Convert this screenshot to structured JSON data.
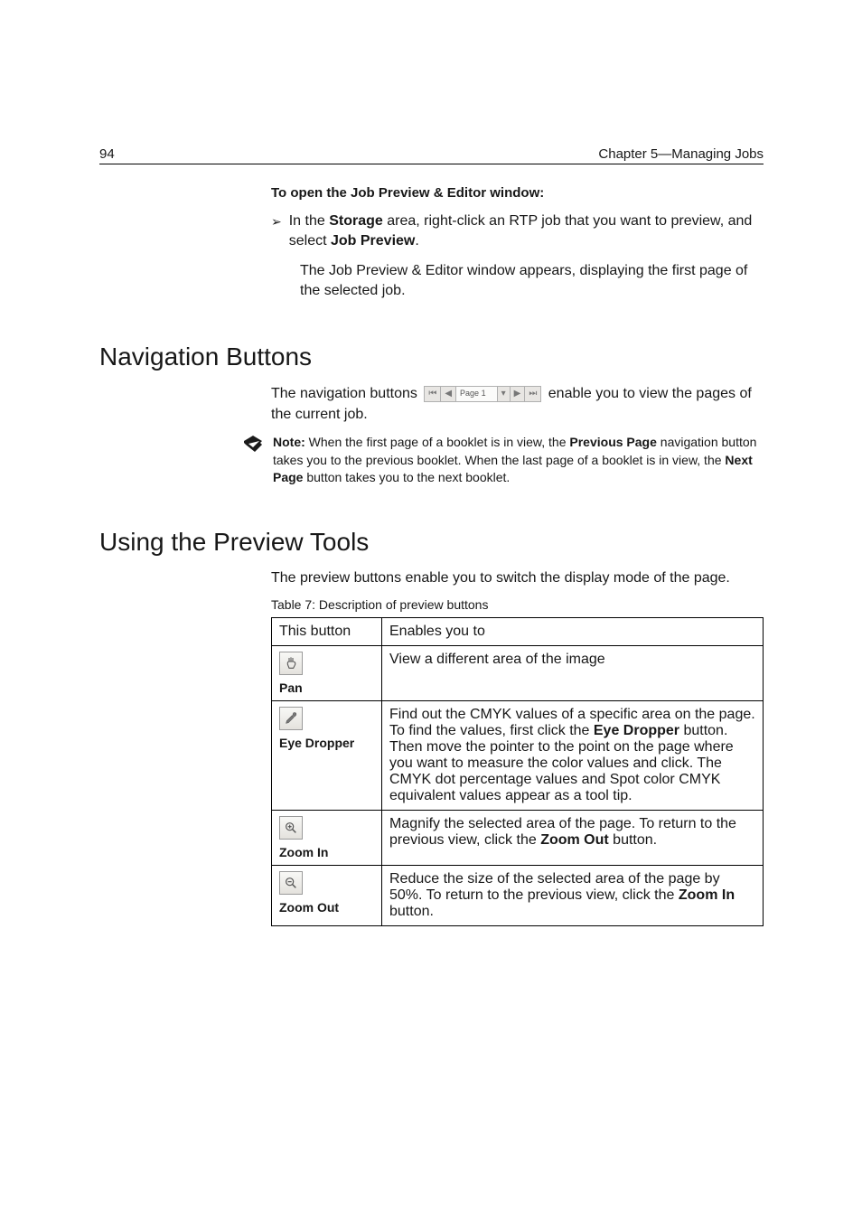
{
  "header": {
    "page_number": "94",
    "chapter_label": "Chapter 5—Managing Jobs"
  },
  "intro": {
    "heading": "To open the Job Preview & Editor window:",
    "bullet_pre": "In the ",
    "bullet_b1": "Storage",
    "bullet_mid": " area, right-click an RTP job that you want to preview, and select ",
    "bullet_b2": "Job Preview",
    "bullet_post": ".",
    "sub": "The Job Preview & Editor window appears, displaying the first page of the selected job."
  },
  "nav": {
    "heading": "Navigation Buttons",
    "pre": "The navigation buttons ",
    "widget_page": "Page 1",
    "post": " enable you to view the pages of the current job.",
    "note_label": "Note:",
    "note_p1": "  When the first page of a booklet is in view, the ",
    "note_b1": "Previous Page",
    "note_p2": " navigation button takes you to the previous booklet. When the last page of a booklet is in view, the ",
    "note_b2": "Next Page",
    "note_p3": " button takes you to the next booklet."
  },
  "tools": {
    "heading": "Using the Preview Tools",
    "intro": "The preview buttons enable you to switch the display mode of the page.",
    "caption": "Table 7: Description of preview buttons",
    "col1": "This button",
    "col2": "Enables you to",
    "rows": [
      {
        "label": "Pan",
        "desc": "View a different area of the image"
      },
      {
        "label": "Eye Dropper",
        "d1": "Find out the CMYK values of a specific area on the page. To find the values, first click the ",
        "b1": "Eye Dropper",
        "d2": " button. Then move the pointer to the point on the page where you want to measure the color values and click. The CMYK dot percentage values and Spot color CMYK equivalent values appear as a tool tip."
      },
      {
        "label": "Zoom In",
        "d1": "Magnify the selected area of the page. To return to the previous view, click the ",
        "b1": "Zoom Out",
        "d2": " button."
      },
      {
        "label": "Zoom Out",
        "d1": "Reduce the size of the selected area of the page by 50%. To return to the previous view, click the ",
        "b1": "Zoom In",
        "d2": " button."
      }
    ]
  }
}
